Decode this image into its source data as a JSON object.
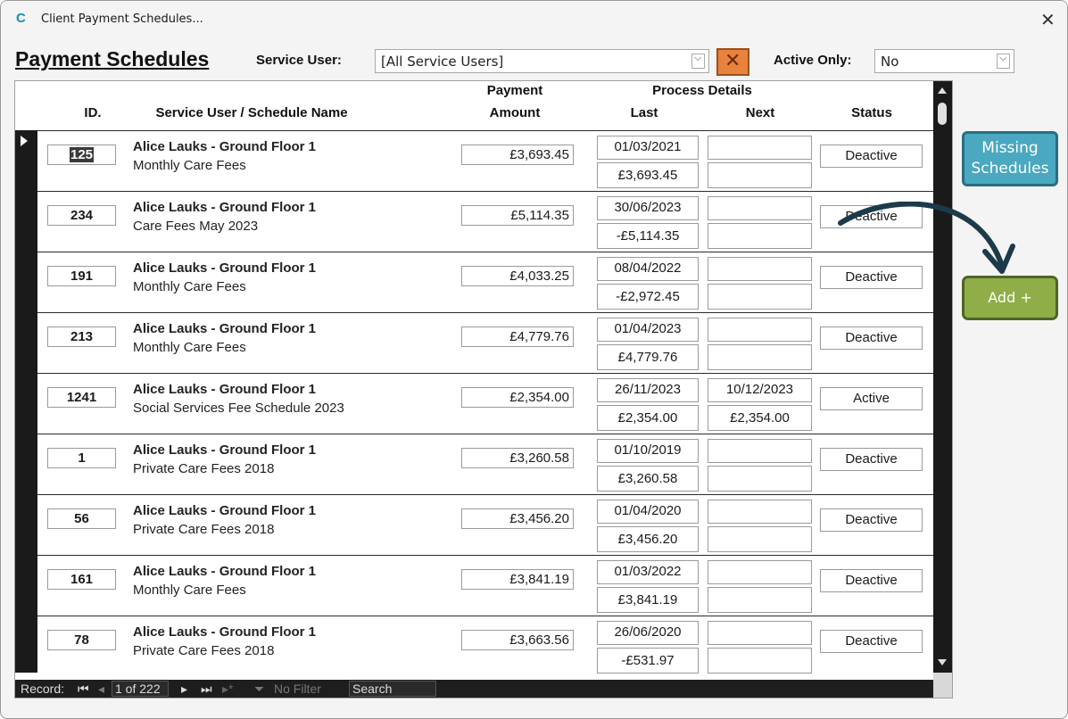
{
  "window": {
    "title": "Client Payment Schedules...",
    "app_icon": "C"
  },
  "header": {
    "page_title": "Payment Schedules",
    "service_user_label": "Service User:",
    "service_user_value": "[All Service Users]",
    "active_only_label": "Active Only:",
    "active_only_value": "No"
  },
  "columns": {
    "id": "ID.",
    "name": "Service User / Schedule Name",
    "payment_top": "Payment",
    "payment_bottom": "Amount",
    "process_top": "Process Details",
    "last": "Last",
    "next": "Next",
    "status": "Status"
  },
  "rows": [
    {
      "id": "125",
      "name": "Alice Lauks - Ground Floor 1",
      "schedule": "Monthly Care Fees",
      "amount": "£3,693.45",
      "last_date": "01/03/2021",
      "last_amount": "£3,693.45",
      "next_date": "",
      "next_amount": "",
      "status": "Deactive"
    },
    {
      "id": "234",
      "name": "Alice Lauks - Ground Floor 1",
      "schedule": "Care Fees May 2023",
      "amount": "£5,114.35",
      "last_date": "30/06/2023",
      "last_amount": "-£5,114.35",
      "next_date": "",
      "next_amount": "",
      "status": "Deactive"
    },
    {
      "id": "191",
      "name": "Alice Lauks - Ground Floor 1",
      "schedule": "Monthly Care Fees",
      "amount": "£4,033.25",
      "last_date": "08/04/2022",
      "last_amount": "-£2,972.45",
      "next_date": "",
      "next_amount": "",
      "status": "Deactive"
    },
    {
      "id": "213",
      "name": "Alice Lauks - Ground Floor 1",
      "schedule": "Monthly Care Fees",
      "amount": "£4,779.76",
      "last_date": "01/04/2023",
      "last_amount": "£4,779.76",
      "next_date": "",
      "next_amount": "",
      "status": "Deactive"
    },
    {
      "id": "1241",
      "name": "Alice Lauks - Ground Floor 1",
      "schedule": "Social Services Fee Schedule 2023",
      "amount": "£2,354.00",
      "last_date": "26/11/2023",
      "last_amount": "£2,354.00",
      "next_date": "10/12/2023",
      "next_amount": "£2,354.00",
      "status": "Active"
    },
    {
      "id": "1",
      "name": "Alice Lauks - Ground Floor 1",
      "schedule": "Private Care Fees 2018",
      "amount": "£3,260.58",
      "last_date": "01/10/2019",
      "last_amount": "£3,260.58",
      "next_date": "",
      "next_amount": "",
      "status": "Deactive"
    },
    {
      "id": "56",
      "name": "Alice Lauks - Ground Floor 1",
      "schedule": "Private Care Fees 2018",
      "amount": "£3,456.20",
      "last_date": "01/04/2020",
      "last_amount": "£3,456.20",
      "next_date": "",
      "next_amount": "",
      "status": "Deactive"
    },
    {
      "id": "161",
      "name": "Alice Lauks - Ground Floor 1",
      "schedule": "Monthly Care Fees",
      "amount": "£3,841.19",
      "last_date": "01/03/2022",
      "last_amount": "£3,841.19",
      "next_date": "",
      "next_amount": "",
      "status": "Deactive"
    },
    {
      "id": "78",
      "name": "Alice Lauks - Ground Floor 1",
      "schedule": "Private Care Fees 2018",
      "amount": "£3,663.56",
      "last_date": "26/06/2020",
      "last_amount": "-£531.97",
      "next_date": "",
      "next_amount": "",
      "status": "Deactive"
    }
  ],
  "navigator": {
    "record_label": "Record:",
    "position": "1 of 222",
    "filter_label": "No Filter",
    "search_label": "Search"
  },
  "buttons": {
    "missing_line1": "Missing",
    "missing_line2": "Schedules",
    "add": "Add +"
  },
  "colors": {
    "missing_button": "#4aa8c0",
    "add_button": "#8fae47",
    "clear_filter_button": "#e8823c",
    "annotation_arrow": "#1c3a4a"
  }
}
